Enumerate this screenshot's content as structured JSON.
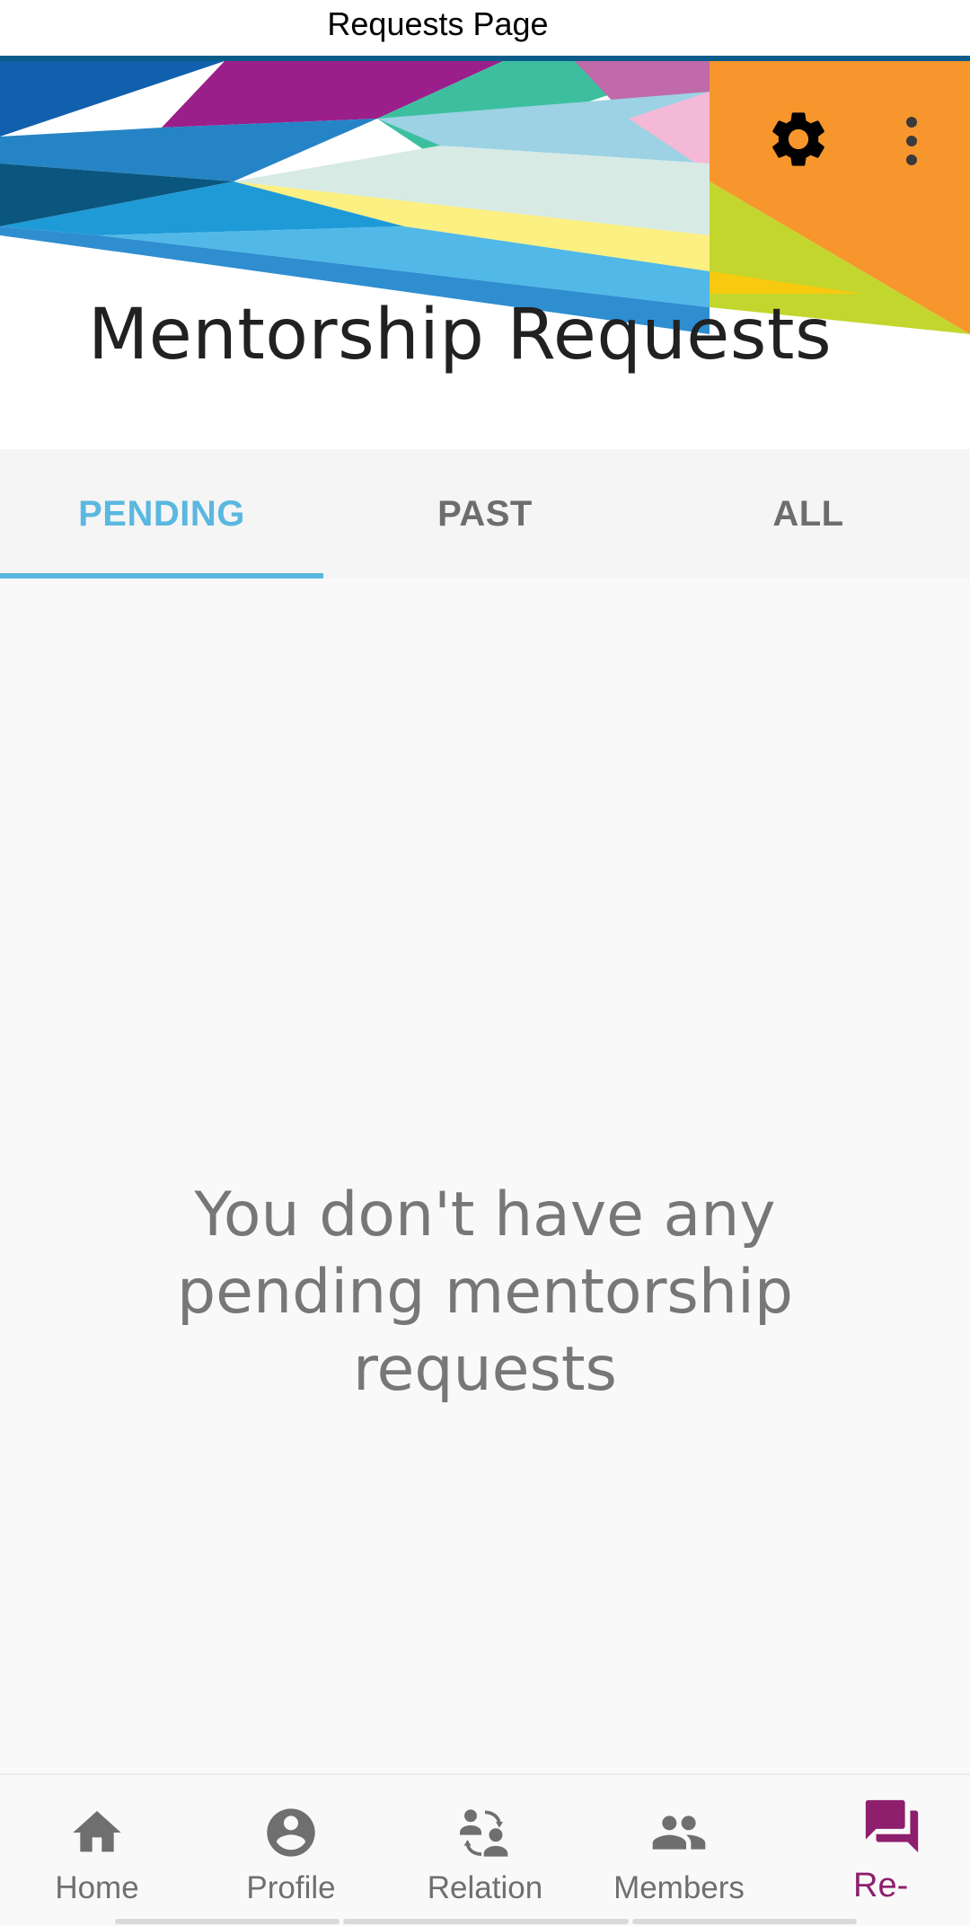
{
  "window": {
    "title": "Requests Page"
  },
  "header": {
    "title": "Mentorship Requests",
    "settings_icon": "gear-icon",
    "more_icon": "more-vertical-icon"
  },
  "tabs": [
    {
      "label": "PENDING",
      "active": true
    },
    {
      "label": "PAST",
      "active": false
    },
    {
      "label": "ALL",
      "active": false
    }
  ],
  "empty_state": {
    "message": "You don't have any pending mentorship requests"
  },
  "bottom_nav": [
    {
      "label": "Home",
      "icon": "home-icon",
      "active": false
    },
    {
      "label": "Profile",
      "icon": "profile-icon",
      "active": false
    },
    {
      "label": "Relation",
      "icon": "relation-icon",
      "active": false
    },
    {
      "label": "Members",
      "icon": "members-icon",
      "active": false
    },
    {
      "label": "Re-",
      "icon": "requests-icon",
      "active": true
    }
  ],
  "colors": {
    "accent": "#5ab8e0",
    "active_nav": "#8e1f6c",
    "inactive": "#6f6f6f"
  }
}
